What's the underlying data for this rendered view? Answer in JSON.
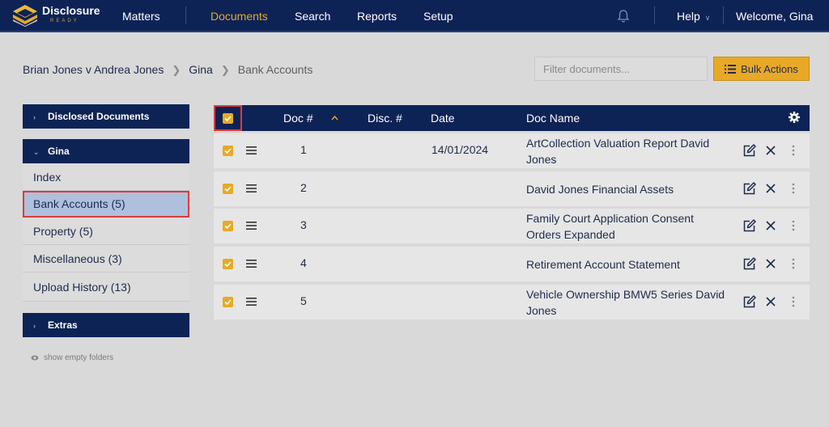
{
  "app": {
    "logo_text": "Disclosure",
    "logo_sub": "READY"
  },
  "nav": {
    "items": [
      "Matters",
      "Documents",
      "Search",
      "Reports",
      "Setup"
    ],
    "active": "Documents",
    "help": "Help",
    "welcome": "Welcome, Gina"
  },
  "breadcrumb": [
    "Brian Jones v Andrea Jones",
    "Gina",
    "Bank Accounts"
  ],
  "filter": {
    "placeholder": "Filter documents..."
  },
  "bulk_actions": {
    "label": "Bulk Actions"
  },
  "sidebar": {
    "disclosed": "Disclosed Documents",
    "gina": "Gina",
    "items": [
      "Index",
      "Bank Accounts (5)",
      "Property (5)",
      "Miscellaneous (3)",
      "Upload History (13)"
    ],
    "selected": "Bank Accounts (5)",
    "extras": "Extras",
    "show_empty": "show empty folders"
  },
  "table": {
    "columns": [
      "Doc #",
      "Disc. #",
      "Date",
      "Doc Name"
    ],
    "rows": [
      {
        "doc": "1",
        "disc": "",
        "date": "14/01/2024",
        "name": "ArtCollection Valuation Report David Jones",
        "checked": true
      },
      {
        "doc": "2",
        "disc": "",
        "date": "",
        "name": "David Jones Financial Assets",
        "checked": true
      },
      {
        "doc": "3",
        "disc": "",
        "date": "",
        "name": "Family Court Application Consent Orders Expanded",
        "checked": true
      },
      {
        "doc": "4",
        "disc": "",
        "date": "",
        "name": "Retirement Account Statement",
        "checked": true
      },
      {
        "doc": "5",
        "disc": "",
        "date": "",
        "name": "Vehicle Ownership BMW5 Series David Jones",
        "checked": true
      }
    ]
  },
  "colors": {
    "navy": "#0d2356",
    "accent": "#e8a927",
    "selected_bg": "#aec0dc",
    "highlight_border": "#e03a3a"
  },
  "icons": {
    "bell": "bell-icon",
    "settings": "gear-icon",
    "edit": "edit-icon",
    "delete": "close-icon",
    "more": "kebab-icon",
    "drag": "hamburger-icon",
    "bulk": "list-icon",
    "eye": "eye-icon"
  }
}
